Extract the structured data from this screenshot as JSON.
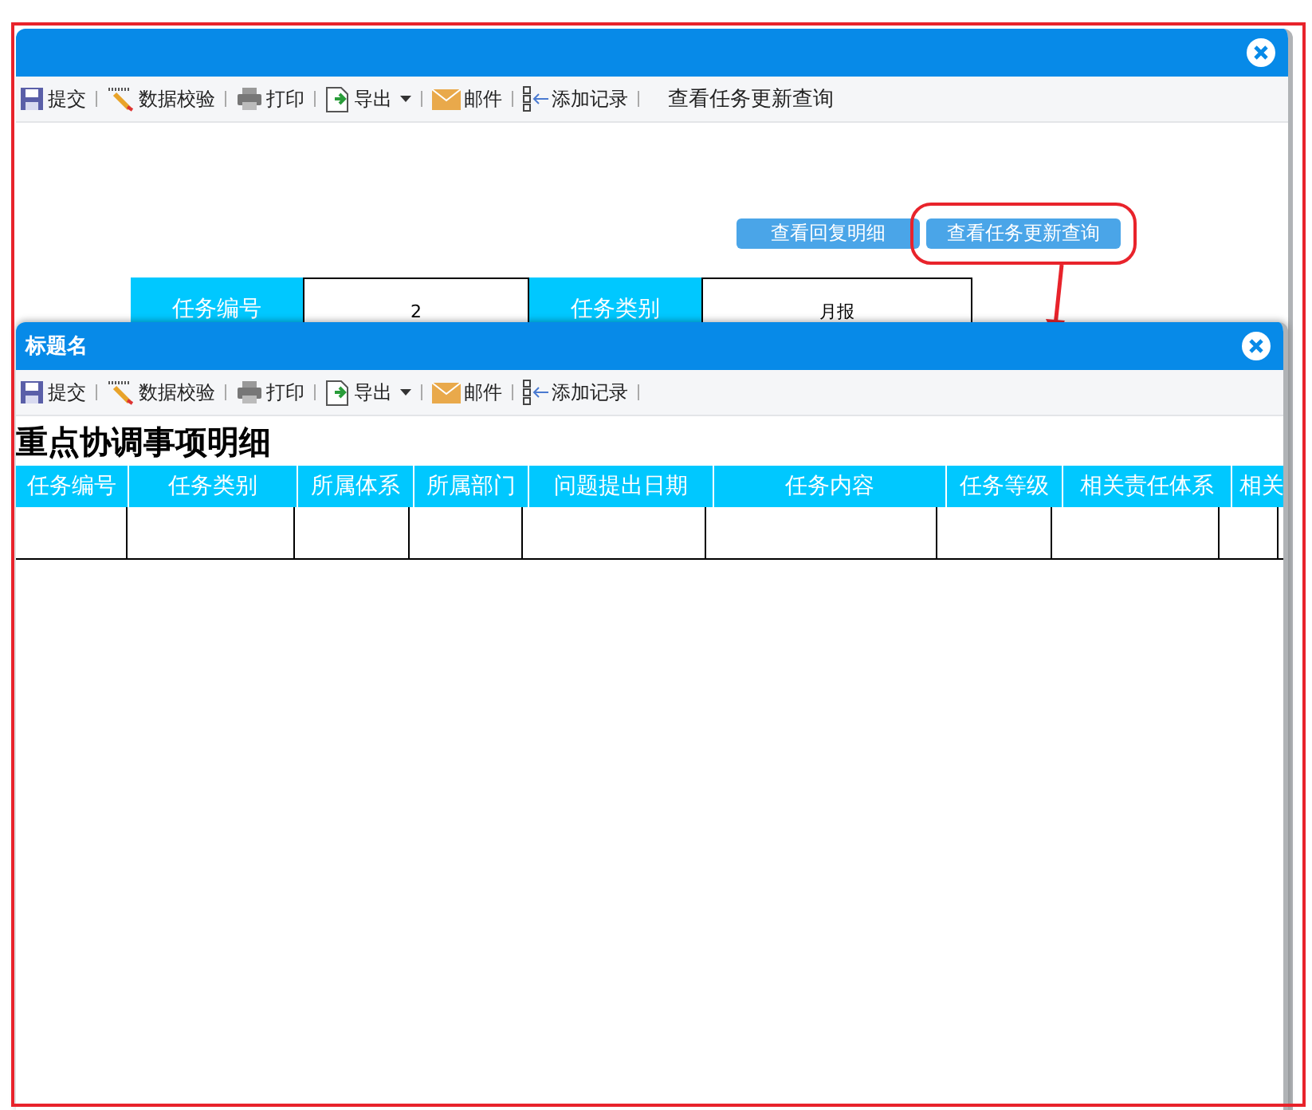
{
  "outer_dialog": {
    "toolbar": [
      {
        "kind": "save",
        "label": "提交",
        "dropdown": false
      },
      {
        "kind": "check",
        "label": "数据校验",
        "dropdown": false
      },
      {
        "kind": "print",
        "label": "打印",
        "dropdown": false
      },
      {
        "kind": "export",
        "label": "导出",
        "dropdown": true
      },
      {
        "kind": "mail",
        "label": "邮件",
        "dropdown": false
      },
      {
        "kind": "add",
        "label": "添加记录",
        "dropdown": false
      },
      {
        "kind": "text",
        "label": "查看任务更新查询",
        "dropdown": false
      }
    ],
    "buttons": [
      {
        "label": "查看回复明细",
        "highlighted": false
      },
      {
        "label": "查看任务更新查询",
        "highlighted": true
      }
    ],
    "form": [
      {
        "kind": "label",
        "text": "任务编号"
      },
      {
        "kind": "value",
        "text": "2"
      },
      {
        "kind": "label",
        "text": "任务类别"
      },
      {
        "kind": "value",
        "text": "月报"
      }
    ]
  },
  "inner_dialog": {
    "title": "标题名",
    "toolbar": [
      {
        "kind": "save",
        "label": "提交",
        "dropdown": false
      },
      {
        "kind": "check",
        "label": "数据校验",
        "dropdown": false
      },
      {
        "kind": "print",
        "label": "打印",
        "dropdown": false
      },
      {
        "kind": "export",
        "label": "导出",
        "dropdown": true
      },
      {
        "kind": "mail",
        "label": "邮件",
        "dropdown": false
      },
      {
        "kind": "add",
        "label": "添加记录",
        "dropdown": false
      }
    ],
    "heading": "重点协调事项明细",
    "table": {
      "columns": [
        "任务编号",
        "任务类别",
        "所属体系",
        "所属部门",
        "问题提出日期",
        "任务内容",
        "任务等级",
        "相关责任体系",
        "相关"
      ]
    }
  }
}
